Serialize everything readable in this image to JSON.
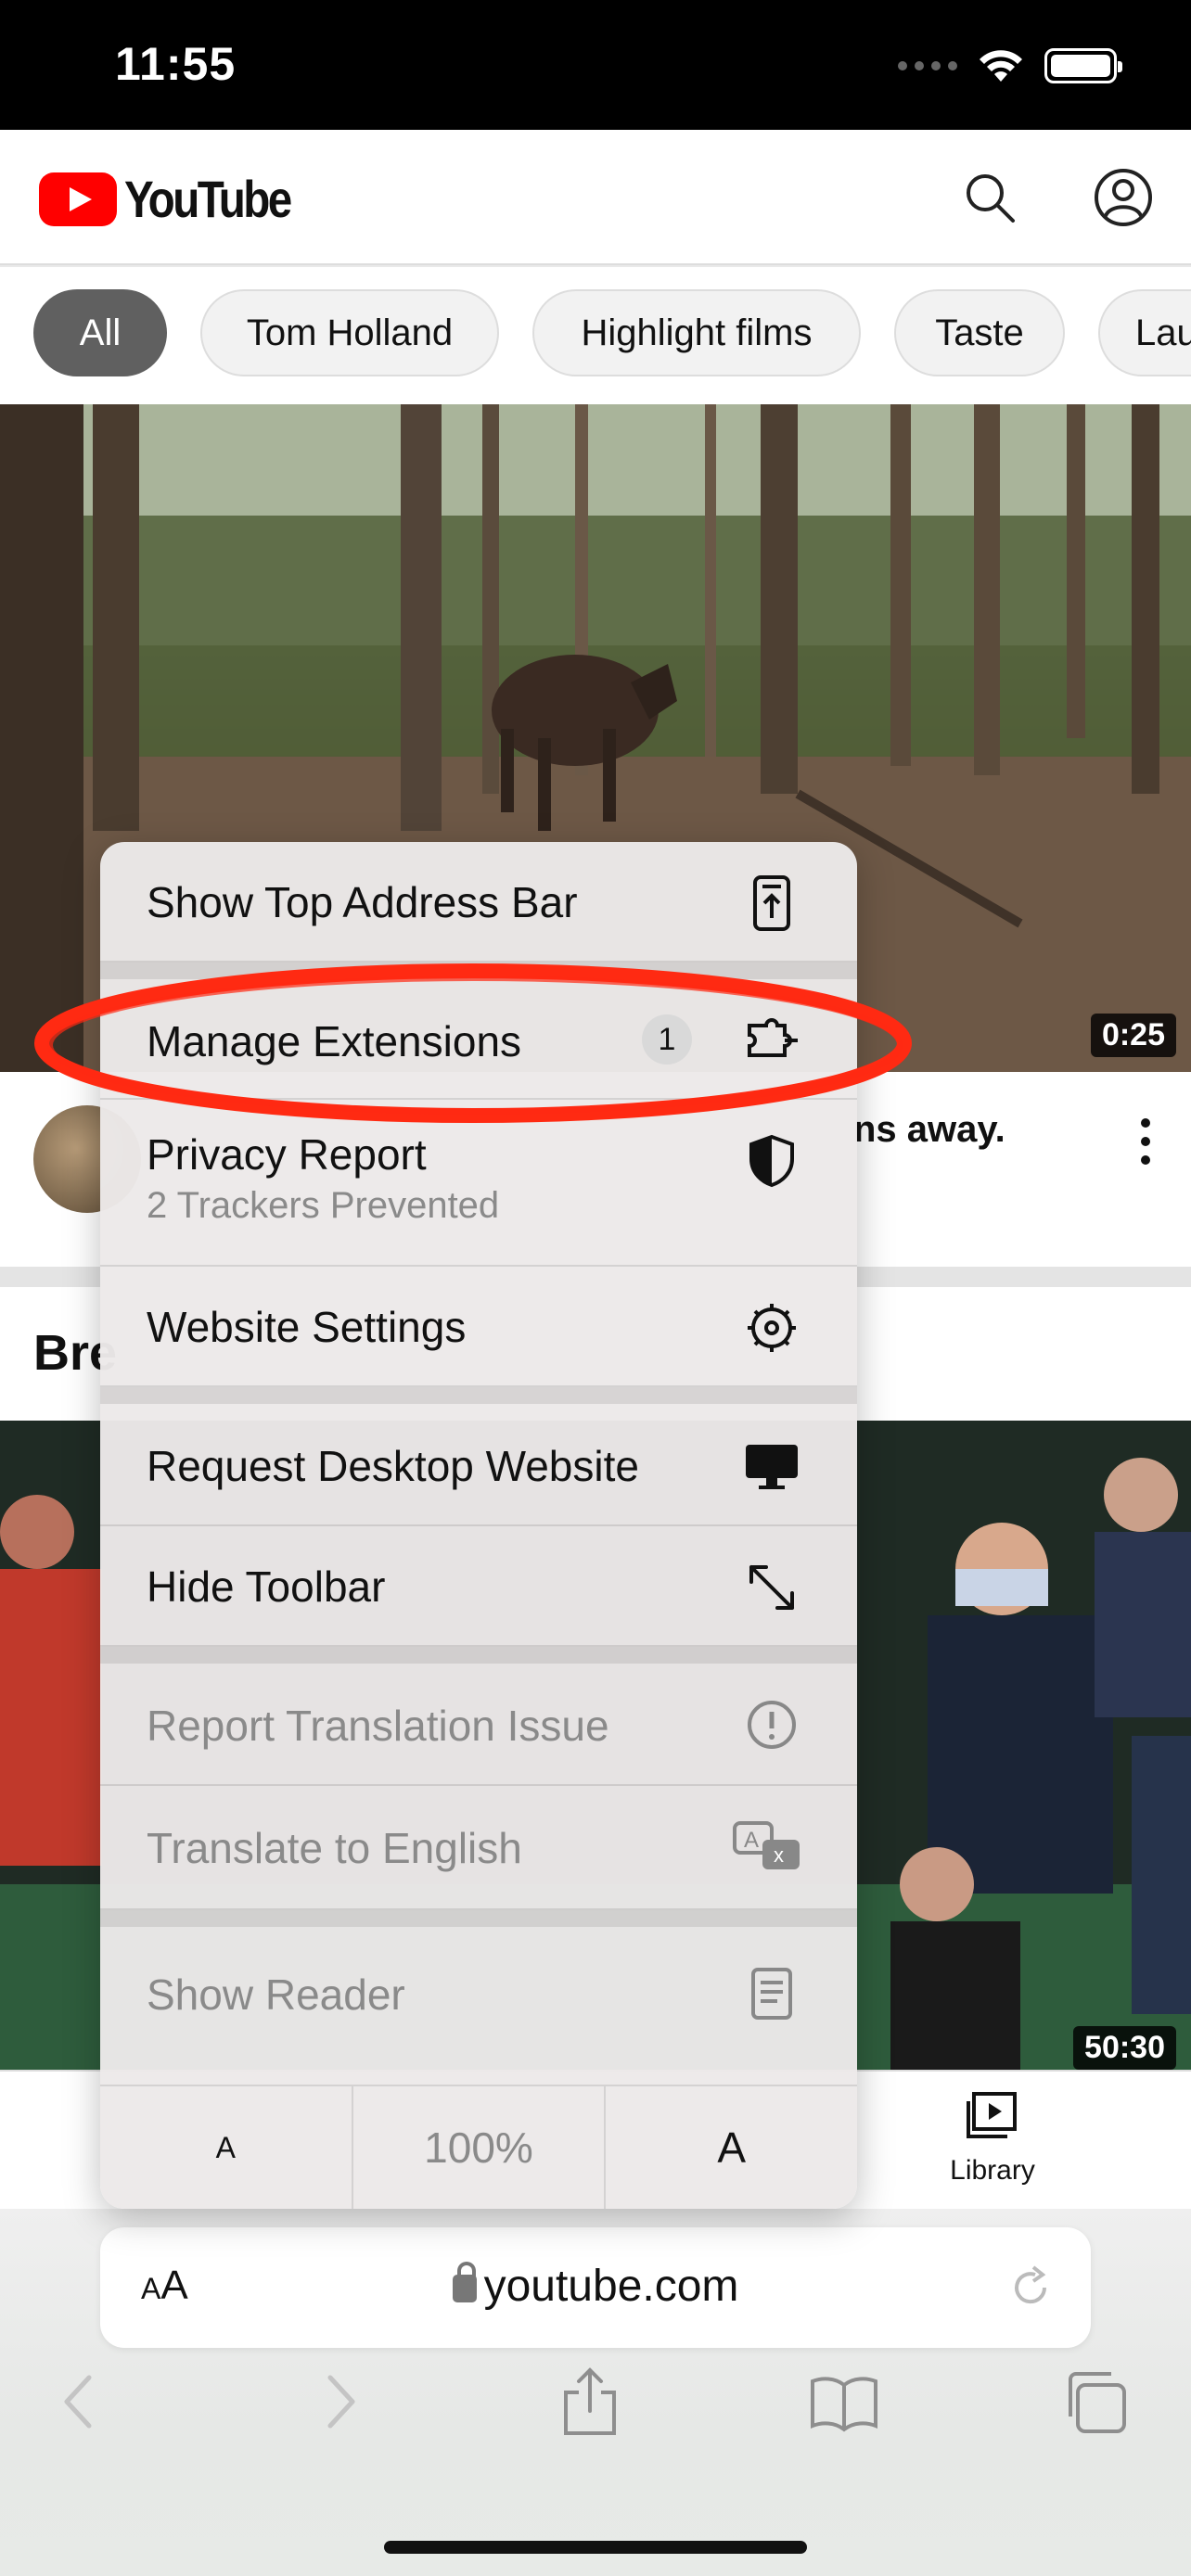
{
  "status_bar": {
    "time": "11:55"
  },
  "youtube": {
    "brand": "YouTube",
    "chips": [
      {
        "label": "All",
        "active": true
      },
      {
        "label": "Tom Holland",
        "active": false
      },
      {
        "label": "Highlight films",
        "active": false
      },
      {
        "label": "Taste",
        "active": false
      },
      {
        "label": "Lau",
        "active": false
      }
    ],
    "video1": {
      "duration": "0:25",
      "partial_title": "ns away."
    },
    "shelf_title_partial": "Bre",
    "video2": {
      "duration": "50:30"
    },
    "bottom_nav": {
      "library_label": "Library"
    }
  },
  "menu": {
    "items": [
      {
        "label": "Show Top Address Bar",
        "icon": "address-bar-top-icon"
      },
      {
        "label": "Manage Extensions",
        "badge": "1",
        "icon": "extensions-icon"
      },
      {
        "label": "Privacy Report",
        "sub": "2 Trackers Prevented",
        "icon": "shield-icon"
      },
      {
        "label": "Website Settings",
        "icon": "gear-icon"
      },
      {
        "label": "Request Desktop Website",
        "icon": "desktop-icon"
      },
      {
        "label": "Hide Toolbar",
        "icon": "expand-arrows-icon"
      },
      {
        "label": "Report Translation Issue",
        "icon": "exclamation-circle-icon",
        "disabled": true
      },
      {
        "label": "Translate to English",
        "icon": "translate-icon",
        "disabled": true
      },
      {
        "label": "Show Reader",
        "icon": "reader-icon",
        "disabled": true
      }
    ],
    "zoom": {
      "decrease": "A",
      "level": "100%",
      "increase": "A"
    }
  },
  "safari": {
    "text_size_label_small": "A",
    "text_size_label_large": "A",
    "url": "youtube.com"
  },
  "annotation_color": "#ff2a12"
}
